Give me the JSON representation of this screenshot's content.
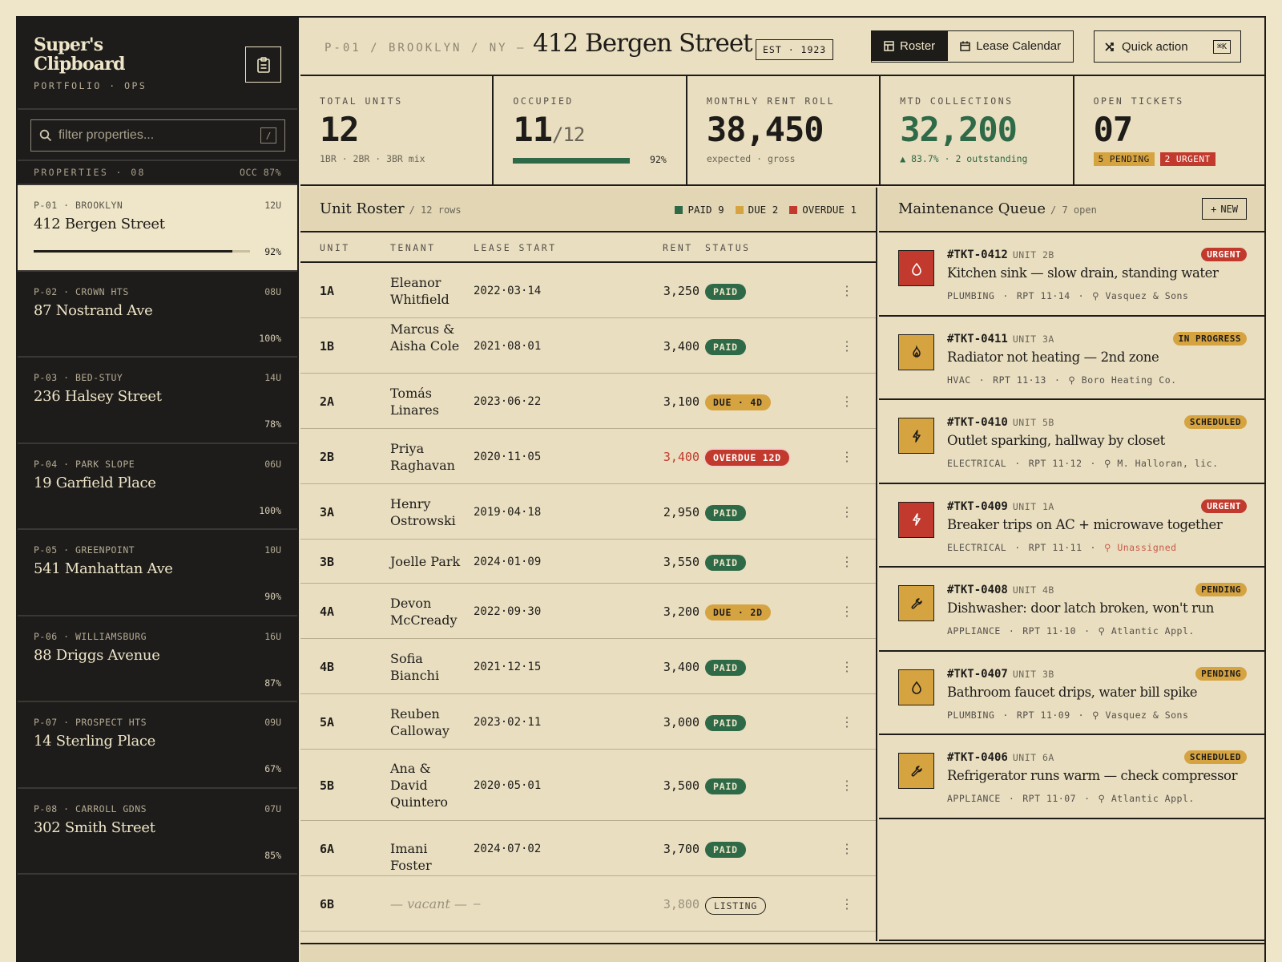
{
  "brand": {
    "name": "Super's Clipboard",
    "subtitle": "PORTFOLIO · OPS",
    "icon": "clipboard-icon"
  },
  "search": {
    "placeholder": "filter properties...",
    "shortcut": "/"
  },
  "properties_header": {
    "label": "PROPERTIES · 08",
    "occupancy": "OCC 87%"
  },
  "properties": [
    {
      "meta": "P-01 · BROOKLYN",
      "units": "12U",
      "name": "412 Bergen Street",
      "pct": "92%",
      "occ": 0.92,
      "active": true
    },
    {
      "meta": "P-02 · CROWN HTS",
      "units": "08U",
      "name": "87 Nostrand Ave",
      "pct": "100%",
      "occ": 1.0
    },
    {
      "meta": "P-03 · BED-STUY",
      "units": "14U",
      "name": "236 Halsey Street",
      "pct": "78%",
      "occ": 0.78
    },
    {
      "meta": "P-04 · PARK SLOPE",
      "units": "06U",
      "name": "19 Garfield Place",
      "pct": "100%",
      "occ": 1.0
    },
    {
      "meta": "P-05 · GREENPOINT",
      "units": "10U",
      "name": "541 Manhattan Ave",
      "pct": "90%",
      "occ": 0.9
    },
    {
      "meta": "P-06 · WILLIAMSBURG",
      "units": "16U",
      "name": "88 Driggs Avenue",
      "pct": "87%",
      "occ": 0.87
    },
    {
      "meta": "P-07 · PROSPECT HTS",
      "units": "09U",
      "name": "14 Sterling Place",
      "pct": "67%",
      "occ": 0.67
    },
    {
      "meta": "P-08 · CARROLL GDNS",
      "units": "07U",
      "name": "302 Smith Street",
      "pct": "85%",
      "occ": 0.85
    }
  ],
  "header": {
    "breadcrumb": "P-01 / BROOKLYN / NY —",
    "title": "412 Bergen Street",
    "est": "EST · 1923",
    "tabs": [
      {
        "label": "Roster",
        "icon": "grid-icon"
      },
      {
        "label": "Lease Calendar",
        "icon": "calendar-icon"
      }
    ],
    "quick_action": {
      "label": "Quick action",
      "kbd": "⌘K",
      "icon": "shuffle-icon"
    }
  },
  "stats": {
    "total_units": {
      "label": "TOTAL UNITS",
      "value": "12",
      "sub": "1BR · 2BR · 3BR mix"
    },
    "occupied": {
      "label": "OCCUPIED",
      "value": "11",
      "of": "/12",
      "pct": "92%",
      "fraction": 0.92
    },
    "rent_roll": {
      "label": "MONTHLY RENT ROLL",
      "value": "38,450",
      "sub": "expected · gross"
    },
    "collections": {
      "label": "MTD COLLECTIONS",
      "value": "32,200",
      "sub": "▲ 83.7% · 2 outstanding"
    },
    "tickets": {
      "label": "OPEN TICKETS",
      "value": "07",
      "pending": "5 PENDING",
      "urgent": "2 URGENT"
    }
  },
  "roster": {
    "title": "Unit Roster",
    "count": "/ 12 rows",
    "legend": [
      {
        "label": "PAID 9",
        "color": "#2e6a47"
      },
      {
        "label": "DUE 2",
        "color": "#d6a341"
      },
      {
        "label": "OVERDUE 1",
        "color": "#c23a2d"
      }
    ],
    "columns": {
      "unit": "UNIT",
      "tenant": "TENANT",
      "lease": "LEASE START",
      "rent": "RENT",
      "status": "STATUS"
    },
    "rows": [
      {
        "unit": "1A",
        "tenant": "Eleanor Whitfield",
        "lease": "2022·03·14",
        "rent": "3,250",
        "status": "PAID",
        "kind": "paid"
      },
      {
        "unit": "1B",
        "tenant": "Marcus & Aisha Cole",
        "lease": "2021·08·01",
        "rent": "3,400",
        "status": "PAID",
        "kind": "paid"
      },
      {
        "unit": "2A",
        "tenant": "Tomás Linares",
        "lease": "2023·06·22",
        "rent": "3,100",
        "status": "DUE · 4D",
        "kind": "due"
      },
      {
        "unit": "2B",
        "tenant": "Priya Raghavan",
        "lease": "2020·11·05",
        "rent": "3,400",
        "status": "OVERDUE 12D",
        "kind": "over"
      },
      {
        "unit": "3A",
        "tenant": "Henry Ostrowski",
        "lease": "2019·04·18",
        "rent": "2,950",
        "status": "PAID",
        "kind": "paid"
      },
      {
        "unit": "3B",
        "tenant": "Joelle Park",
        "lease": "2024·01·09",
        "rent": "3,550",
        "status": "PAID",
        "kind": "paid"
      },
      {
        "unit": "4A",
        "tenant": "Devon McCready",
        "lease": "2022·09·30",
        "rent": "3,200",
        "status": "DUE · 2D",
        "kind": "due"
      },
      {
        "unit": "4B",
        "tenant": "Sofia Bianchi",
        "lease": "2021·12·15",
        "rent": "3,400",
        "status": "PAID",
        "kind": "paid"
      },
      {
        "unit": "5A",
        "tenant": "Reuben Calloway",
        "lease": "2023·02·11",
        "rent": "3,000",
        "status": "PAID",
        "kind": "paid"
      },
      {
        "unit": "5B",
        "tenant": "Ana & David Quintero",
        "lease": "2020·05·01",
        "rent": "3,500",
        "status": "PAID",
        "kind": "paid"
      },
      {
        "unit": "6A",
        "tenant": "Imani Foster",
        "lease": "2024·07·02",
        "rent": "3,700",
        "status": "PAID",
        "kind": "paid"
      },
      {
        "unit": "6B",
        "tenant": "— vacant —",
        "lease": "—",
        "rent": "3,800",
        "status": "LISTING",
        "kind": "listing"
      }
    ]
  },
  "maintenance": {
    "title": "Maintenance Queue",
    "count": "/ 7 open",
    "new_label": "NEW",
    "tickets": [
      {
        "id": "#TKT-0412",
        "unit": "UNIT 2B",
        "badge": "URGENT",
        "badge_kind": "urgent",
        "title": "Kitchen sink — slow drain, standing water",
        "category": "PLUMBING",
        "reported": "RPT 11·14",
        "assignee": "Vasquez & Sons",
        "icon": "droplet-icon",
        "icon_kind": "red"
      },
      {
        "id": "#TKT-0411",
        "unit": "UNIT 3A",
        "badge": "IN PROGRESS",
        "badge_kind": "amber",
        "title": "Radiator not heating — 2nd zone",
        "category": "HVAC",
        "reported": "RPT 11·13",
        "assignee": "Boro Heating Co.",
        "icon": "flame-icon",
        "icon_kind": "amber"
      },
      {
        "id": "#TKT-0410",
        "unit": "UNIT 5B",
        "badge": "SCHEDULED",
        "badge_kind": "amber",
        "title": "Outlet sparking, hallway by closet",
        "category": "ELECTRICAL",
        "reported": "RPT 11·12",
        "assignee": "M. Halloran, lic.",
        "icon": "bolt-icon",
        "icon_kind": "amber"
      },
      {
        "id": "#TKT-0409",
        "unit": "UNIT 1A",
        "badge": "URGENT",
        "badge_kind": "urgent",
        "title": "Breaker trips on AC + microwave together",
        "category": "ELECTRICAL",
        "reported": "RPT 11·11",
        "assignee": "Unassigned",
        "icon": "bolt-icon",
        "icon_kind": "red",
        "unassigned": true
      },
      {
        "id": "#TKT-0408",
        "unit": "UNIT 4B",
        "badge": "PENDING",
        "badge_kind": "amber",
        "title": "Dishwasher: door latch broken, won't run",
        "category": "APPLIANCE",
        "reported": "RPT 11·10",
        "assignee": "Atlantic Appl.",
        "icon": "wrench-icon",
        "icon_kind": "amber"
      },
      {
        "id": "#TKT-0407",
        "unit": "UNIT 3B",
        "badge": "PENDING",
        "badge_kind": "amber",
        "title": "Bathroom faucet drips, water bill spike",
        "category": "PLUMBING",
        "reported": "RPT 11·09",
        "assignee": "Vasquez & Sons",
        "icon": "droplet-icon",
        "icon_kind": "amber"
      },
      {
        "id": "#TKT-0406",
        "unit": "UNIT 6A",
        "badge": "SCHEDULED",
        "badge_kind": "amber",
        "title": "Refrigerator runs warm — check compressor",
        "category": "APPLIANCE",
        "reported": "RPT 11·07",
        "assignee": "Atlantic Appl.",
        "icon": "wrench-icon",
        "icon_kind": "amber"
      }
    ]
  }
}
